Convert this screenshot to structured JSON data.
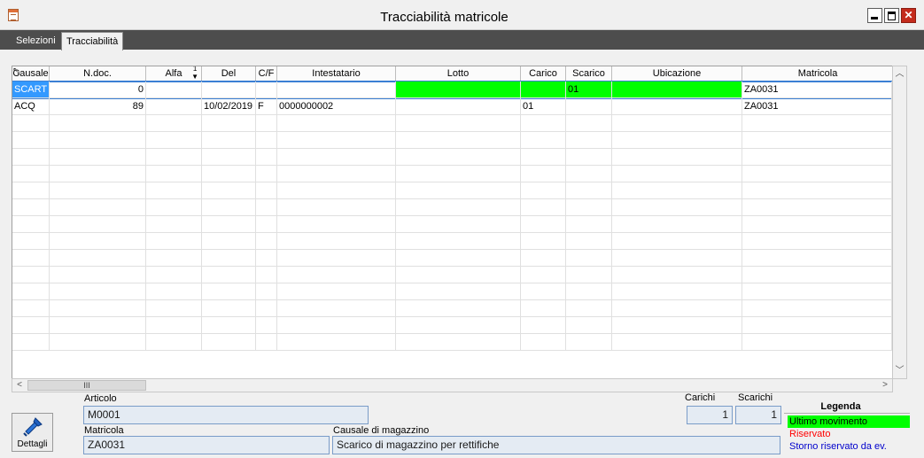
{
  "window": {
    "title": "Tracciabilità matricole",
    "close_glyph": "✕"
  },
  "tabs": [
    {
      "label": "Selezioni",
      "active": false
    },
    {
      "label": "Tracciabilità",
      "active": true
    }
  ],
  "grid": {
    "sort_indicator": "1",
    "columns": [
      "Causale",
      "N.doc.",
      "Alfa",
      "Del",
      "C/F",
      "Intestatario",
      "Lotto",
      "Carico",
      "Scarico",
      "Ubicazione",
      "Matricola"
    ],
    "rows": [
      {
        "causale": "SCART",
        "ndoc": "0",
        "alfa": "",
        "del": "",
        "cf": "",
        "intestatario": "",
        "lotto": "",
        "carico": "",
        "scarico": "01",
        "ubicazione": "",
        "matricola": "ZA0031"
      },
      {
        "causale": "ACQ",
        "ndoc": "89",
        "alfa": "",
        "del": "10/02/2019",
        "cf": "F",
        "intestatario": "0000000002",
        "lotto": "",
        "carico": "01",
        "scarico": "",
        "ubicazione": "",
        "matricola": "ZA0031"
      }
    ],
    "empty_rows": 14,
    "hscroll_thumb_label": "III"
  },
  "detail": {
    "articolo_label": "Articolo",
    "articolo_value": "M0001",
    "matricola_label": "Matricola",
    "matricola_value": "ZA0031",
    "causale_label": "Causale di magazzino",
    "causale_value": "Scarico di magazzino per rettifiche",
    "carichi_label": "Carichi",
    "carichi_value": "1",
    "scarichi_label": "Scarichi",
    "scarichi_value": "1",
    "dettagli_button": "Dettagli"
  },
  "legend": {
    "title": "Legenda",
    "items": [
      {
        "label": "Ultimo movimento",
        "color": "#00ff00"
      },
      {
        "label": "Riservato",
        "color": "#ff0000"
      },
      {
        "label": "Storno riservato da ev.",
        "color": "#0000cc"
      }
    ]
  },
  "colors": {
    "tab_bar": "#4d4d4d",
    "highlight": "#00ff00",
    "selection": "#3399ff",
    "field_bg": "#e4ebf3"
  }
}
